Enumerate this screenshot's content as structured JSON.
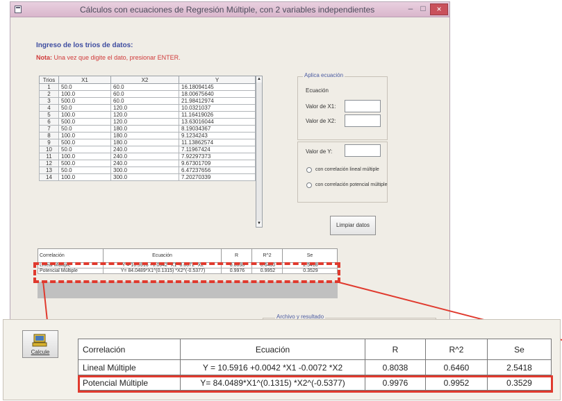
{
  "window": {
    "title": "Cálculos con ecuaciones de Regresión Múltiple, con 2 variables independientes",
    "minimize": "–",
    "maximize": "□",
    "close": "×"
  },
  "intro": {
    "title": "Ingreso de los trios de datos:",
    "note_label": "Nota:",
    "note_text": "Una vez que digite el dato, presionar ENTER."
  },
  "data_grid": {
    "headers": [
      "Trios",
      "X1",
      "X2",
      "Y"
    ],
    "rows": [
      [
        "1",
        "50.0",
        "60.0",
        "16.18094145"
      ],
      [
        "2",
        "100.0",
        "60.0",
        "18.00675640"
      ],
      [
        "3",
        "500.0",
        "60.0",
        "21.98412974"
      ],
      [
        "4",
        "50.0",
        "120.0",
        "10.0321037"
      ],
      [
        "5",
        "100.0",
        "120.0",
        "11.16419026"
      ],
      [
        "6",
        "500.0",
        "120.0",
        "13.63016044"
      ],
      [
        "7",
        "50.0",
        "180.0",
        "8.19034367"
      ],
      [
        "8",
        "100.0",
        "180.0",
        "9.1234243"
      ],
      [
        "9",
        "500.0",
        "180.0",
        "11.13862574"
      ],
      [
        "10",
        "50.0",
        "240.0",
        "7.11967424"
      ],
      [
        "11",
        "100.0",
        "240.0",
        "7.92297373"
      ],
      [
        "12",
        "500.0",
        "240.0",
        "9.67301709"
      ],
      [
        "13",
        "50.0",
        "300.0",
        "6.47237656"
      ],
      [
        "14",
        "100.0",
        "300.0",
        "7.20270339"
      ]
    ]
  },
  "aplica": {
    "caption": "Aplica ecuación",
    "equation_label": "Ecuación",
    "x1_label": "Valor de X1:",
    "x2_label": "Valor de X2:",
    "y_label": "Valor de Y:",
    "radio_linear": "con correlación lineal múltiple",
    "radio_potential": "con correlación potencial múltiple",
    "clear_button": "Limpiar datos"
  },
  "results": {
    "headers": [
      "Correlación",
      "Ecuación",
      "R",
      "R^2",
      "Se"
    ],
    "rows": [
      [
        "Lineal Múltiple",
        "Y = 10.5916 +0.0042 *X1 -0.0072 *X2",
        "0.8038",
        "0.6460",
        "2.5418"
      ],
      [
        "Potencial Múltiple",
        "Y= 84.0489*X1^(0.1315) *X2^(-0.5377)",
        "0.9976",
        "0.9952",
        "0.3529"
      ]
    ]
  },
  "bottom": {
    "archivo_caption": "Archivo y resultado",
    "calc_button": "Calcule"
  },
  "colors": {
    "highlight": "#e03a2e",
    "caption_blue": "#3d4ca0",
    "note_red": "#d03a3a"
  }
}
